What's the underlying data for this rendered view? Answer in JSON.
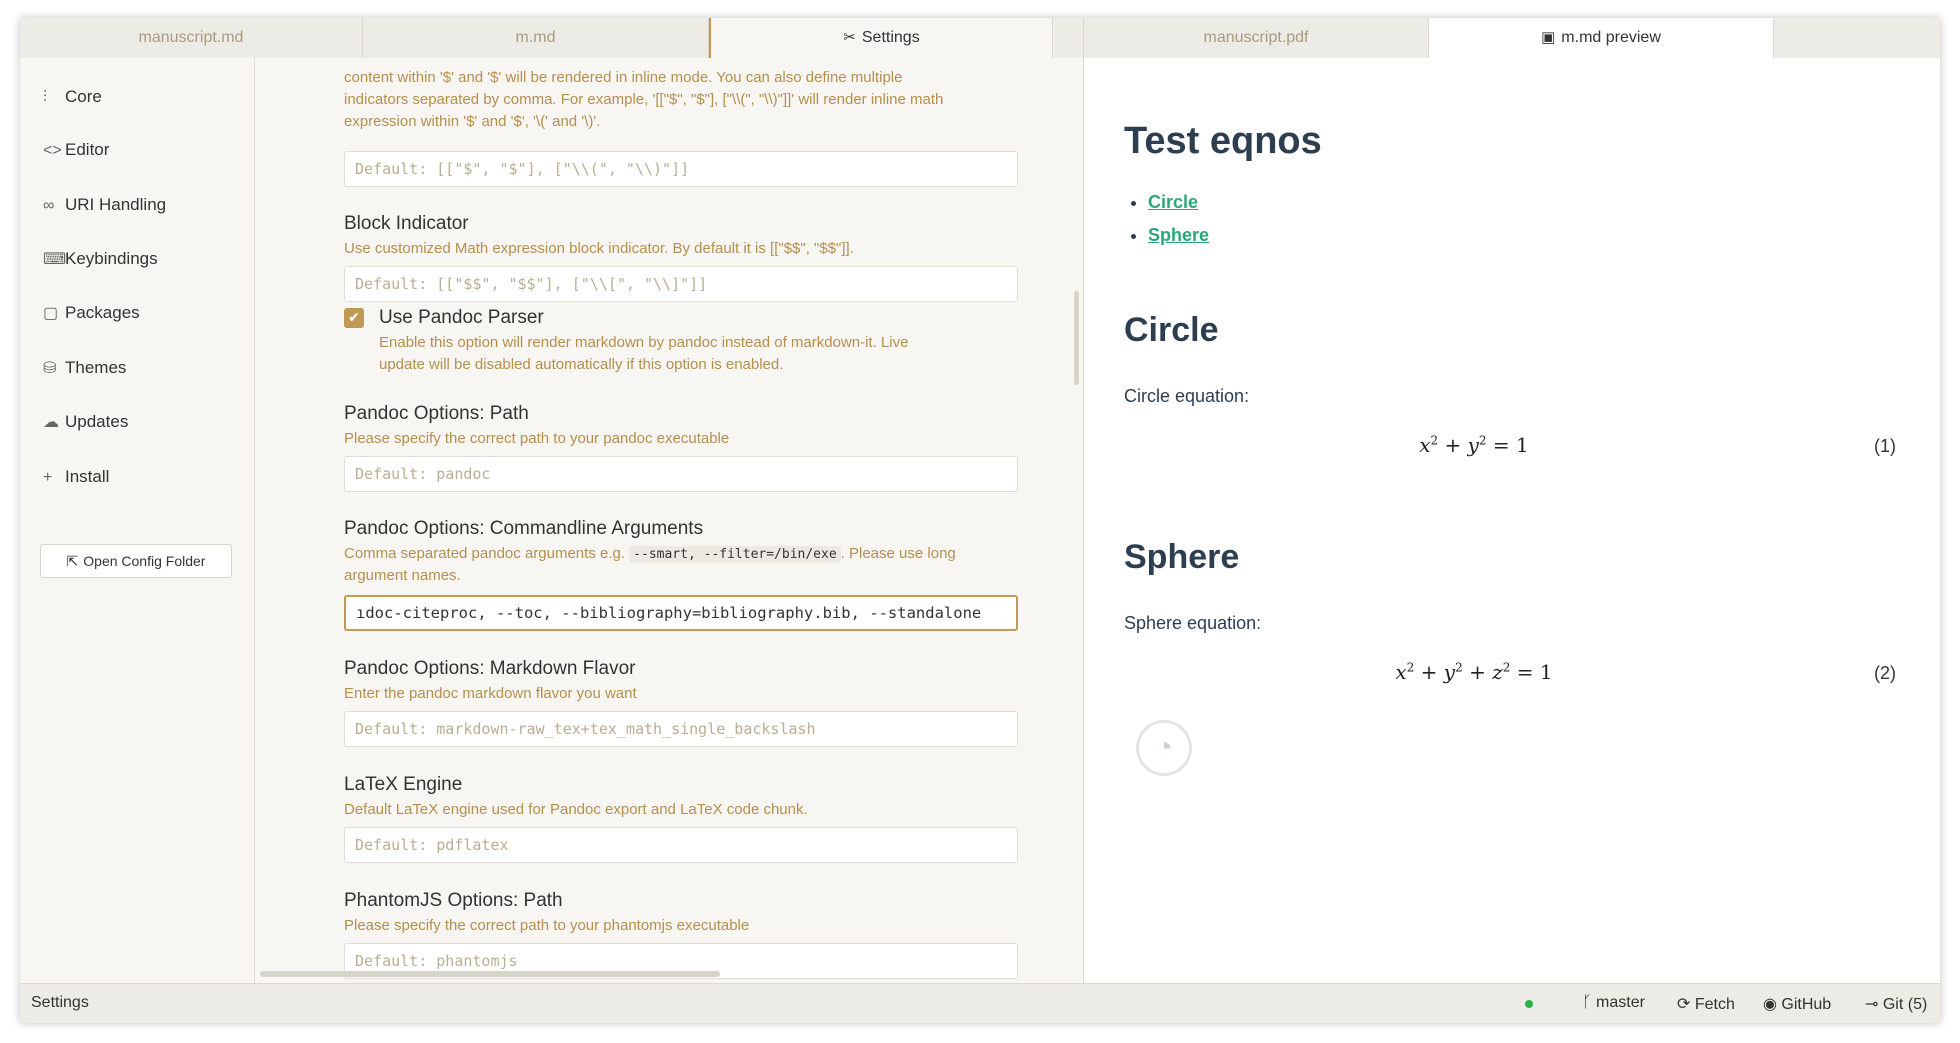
{
  "tabs_left": [
    {
      "label": "manuscript.md"
    },
    {
      "label": "m.md"
    },
    {
      "label": "Settings",
      "icon": "tools-icon"
    }
  ],
  "tabs_right": [
    {
      "label": "manuscript.pdf"
    },
    {
      "label": "m.md preview",
      "icon": "markdown-icon"
    }
  ],
  "sidebar": {
    "items": [
      {
        "label": "Core",
        "icon": "sliders-icon"
      },
      {
        "label": "Editor",
        "icon": "code-icon"
      },
      {
        "label": "URI Handling",
        "icon": "link-icon"
      },
      {
        "label": "Keybindings",
        "icon": "keyboard-icon"
      },
      {
        "label": "Packages",
        "icon": "package-icon"
      },
      {
        "label": "Themes",
        "icon": "paintcan-icon"
      },
      {
        "label": "Updates",
        "icon": "cloud-download-icon"
      },
      {
        "label": "Install",
        "icon": "plus-icon"
      }
    ],
    "open_config_label": "Open Config Folder"
  },
  "settings": {
    "inline": {
      "desc_line1": "content within '$' and '$' will be rendered in inline mode. You can also define multiple",
      "desc_line2": "indicators separated by comma. For example, '[[\"$\", \"$\"], [\"\\\\(\", \"\\\\)\"]]' will render inline math",
      "desc_line3": "expression within '$' and '$', '\\(' and '\\)'.",
      "placeholder": "Default: [[\"$\", \"$\"], [\"\\\\(\", \"\\\\)\"]]"
    },
    "block": {
      "title": "Block Indicator",
      "desc": "Use customized Math expression block indicator. By default it is [[\"$$\", \"$$\"]].",
      "placeholder": "Default: [[\"$$\", \"$$\"], [\"\\\\[\", \"\\\\]\"]]"
    },
    "pandoc_parser": {
      "title": "Use Pandoc Parser",
      "checked": true,
      "desc_line1": "Enable this option will render markdown by pandoc instead of markdown-it. Live",
      "desc_line2": "update will be disabled automatically if this option is enabled."
    },
    "pandoc_path": {
      "title": "Pandoc Options: Path",
      "desc": "Please specify the correct path to your pandoc executable",
      "placeholder": "Default: pandoc"
    },
    "pandoc_args": {
      "title": "Pandoc Options: Commandline Arguments",
      "desc_before": "Comma separated pandoc arguments e.g.",
      "code": "--smart, --filter=/bin/exe",
      "desc_after": ". Please use long",
      "desc_line2": "argument names.",
      "value": "ıdoc-citeproc, --toc, --bibliography=bibliography.bib, --standalone"
    },
    "pandoc_flavor": {
      "title": "Pandoc Options: Markdown Flavor",
      "desc": "Enter the pandoc markdown flavor you want",
      "placeholder": "Default: markdown-raw_tex+tex_math_single_backslash"
    },
    "latex_engine": {
      "title": "LaTeX Engine",
      "desc": "Default LaTeX engine used for Pandoc export and LaTeX code chunk.",
      "placeholder": "Default: pdflatex"
    },
    "phantomjs": {
      "title": "PhantomJS Options: Path",
      "desc": "Please specify the correct path to your phantomjs executable",
      "placeholder": "Default: phantomjs"
    }
  },
  "preview": {
    "title": "Test eqnos",
    "toc": [
      "Circle",
      "Sphere"
    ],
    "circle_heading": "Circle",
    "circle_text": "Circle equation:",
    "circle_eq_num": "(1)",
    "sphere_heading": "Sphere",
    "sphere_text": "Sphere equation:",
    "sphere_eq_num": "(2)"
  },
  "statusbar": {
    "left": "Settings",
    "branch": "master",
    "fetch": "Fetch",
    "github": "GitHub",
    "git": "Git (5)"
  },
  "colors": {
    "accent": "#c09a55",
    "link": "#2aa876",
    "status_ok": "#2bb24c"
  }
}
